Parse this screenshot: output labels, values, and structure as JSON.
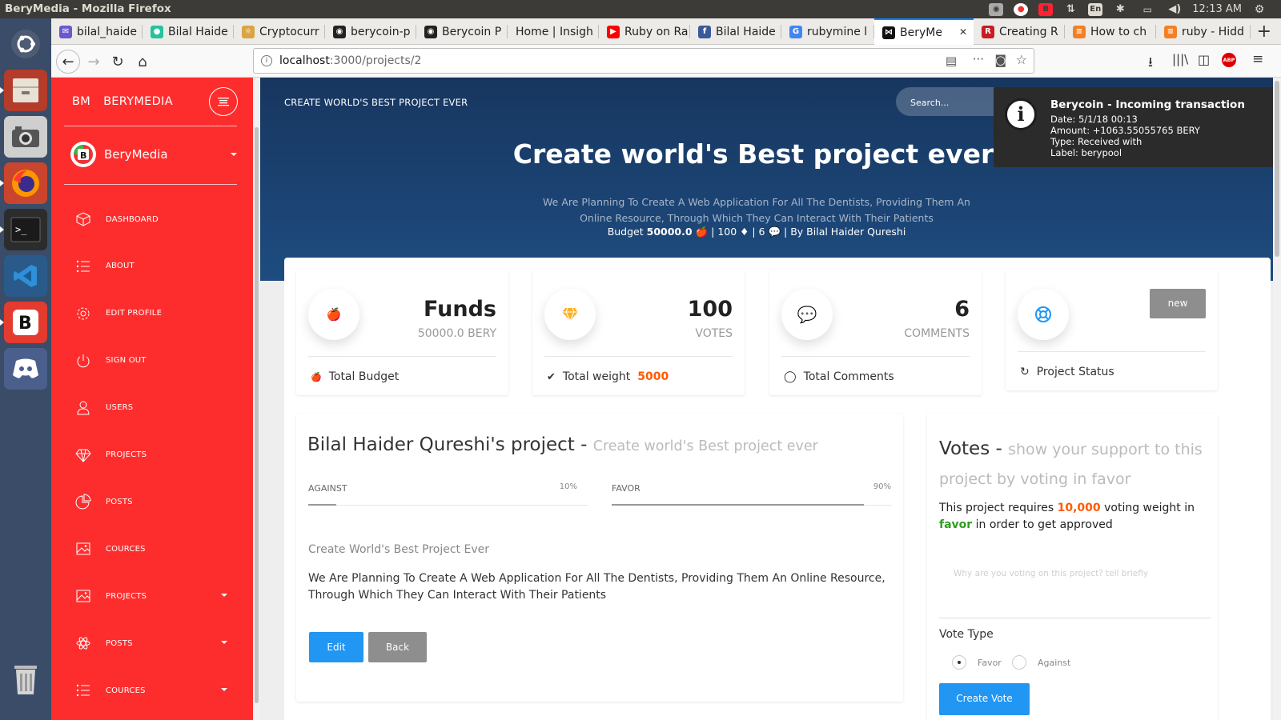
{
  "os": {
    "window_title": "BeryMedia - Mozilla Firefox",
    "tray": {
      "lang": "En",
      "time": "12:13 AM",
      "abp": "ABP"
    }
  },
  "browser": {
    "tabs": [
      {
        "label": "bilal_haide",
        "icon": "mail-icon",
        "color": "#6a5acd"
      },
      {
        "label": "Bilal Haide",
        "icon": "circle-icon",
        "color": "#25c2a0"
      },
      {
        "label": "Cryptocurr",
        "icon": "coin-icon",
        "color": "#d9a441"
      },
      {
        "label": "berycoin-p",
        "icon": "github-icon",
        "color": "#222222"
      },
      {
        "label": "Berycoin P",
        "icon": "github-icon",
        "color": "#222222"
      },
      {
        "label": "Home | Insigh",
        "icon": "",
        "color": ""
      },
      {
        "label": "Ruby on Ra",
        "icon": "youtube-icon",
        "color": "#ff0000"
      },
      {
        "label": "Bilal Haide",
        "icon": "facebook-icon",
        "color": "#3b5998"
      },
      {
        "label": "rubymine l",
        "icon": "google-icon",
        "color": "#4285f4"
      },
      {
        "label": "BeryMe",
        "icon": "bm-icon",
        "color": "#111111"
      },
      {
        "label": "Creating R",
        "icon": "rails-icon",
        "color": "#c61c22"
      },
      {
        "label": "How to ch",
        "icon": "stack-icon",
        "color": "#f48024"
      },
      {
        "label": "ruby - Hidd",
        "icon": "stack-icon",
        "color": "#f48024"
      }
    ],
    "url_host": "localhost",
    "url_path": ":3000/projects/2"
  },
  "sidebar": {
    "logo_short": "BM",
    "logo_name": "BERYMEDIA",
    "user": "BeryMedia",
    "items": [
      {
        "label": "DASHBOARD",
        "icon": "cube-icon",
        "caret": false
      },
      {
        "label": "ABOUT",
        "icon": "list-icon",
        "caret": false
      },
      {
        "label": "EDIT PROFILE",
        "icon": "gear-icon",
        "caret": false
      },
      {
        "label": "SIGN OUT",
        "icon": "power-icon",
        "caret": false
      },
      {
        "label": "USERS",
        "icon": "user-icon",
        "caret": false
      },
      {
        "label": "PROJECTS",
        "icon": "diamond-icon",
        "caret": false
      },
      {
        "label": "POSTS",
        "icon": "pie-icon",
        "caret": false
      },
      {
        "label": "COURCES",
        "icon": "image-icon",
        "caret": false
      },
      {
        "label": "PROJECTS",
        "icon": "image-icon",
        "caret": true
      },
      {
        "label": "POSTS",
        "icon": "atom-icon",
        "caret": true
      },
      {
        "label": "COURCES",
        "icon": "list-icon",
        "caret": true
      }
    ]
  },
  "header": {
    "breadcrumb": "CREATE WORLD'S BEST PROJECT EVER",
    "search_placeholder": "Search...",
    "title": "Create world's Best project ever",
    "description": "We Are Planning To Create A Web Application For All The Dentists, Providing Them An Online Resource, Through Which They Can Interact With Their Patients",
    "meta": {
      "budget_label": "Budget",
      "budget": "50000.0",
      "votes": "100",
      "comments": "6",
      "by": "By Bilal Haider Qureshi"
    }
  },
  "notification": {
    "title": "Berycoin - Incoming transaction",
    "lines": [
      "Date: 5/1/18 00:13",
      "Amount: +1063.55055765 BERY",
      "Type: Received with",
      "Label: berypool"
    ]
  },
  "stats": {
    "funds": {
      "value": "Funds",
      "sub": "50000.0 BERY",
      "footer": "Total Budget"
    },
    "votes": {
      "value": "100",
      "sub": "VOTES",
      "footer": "Total weight",
      "weight": "5000"
    },
    "comments": {
      "value": "6",
      "sub": "COMMENTS",
      "footer": "Total Comments"
    },
    "status": {
      "badge": "new",
      "footer": "Project Status"
    }
  },
  "project": {
    "owner_title": "Bilal Haider Qureshi's project -",
    "subtitle": "Create world's Best project ever",
    "against": {
      "label": "AGAINST",
      "percent": "10%",
      "fraction": 0.1
    },
    "favor": {
      "label": "FAVOR",
      "percent": "90%",
      "fraction": 0.9
    },
    "heading": "Create World's Best Project Ever",
    "body": "We Are Planning To Create A Web Application For All The Dentists, Providing Them An Online Resource, Through Which They Can Interact With Their Patients",
    "edit_label": "Edit",
    "back_label": "Back"
  },
  "votes_panel": {
    "title": "Votes -",
    "subtitle_line1": "show your support to this",
    "subtitle_line2": "project by voting in favor",
    "req_pre": "This project requires",
    "req_weight": "10,000",
    "req_mid": "voting weight in",
    "req_favor": "favor",
    "req_post": "in order to get approved",
    "reason_placeholder": "Why are you voting on this project? tell briefly",
    "vote_type_label": "Vote Type",
    "option_favor": "Favor",
    "option_against": "Against",
    "submit_label": "Create Vote"
  },
  "colors": {
    "sidebar": "#fe2d2d",
    "primary": "#2196f3",
    "accent": "#ff5a00",
    "success": "#2e9e1f"
  }
}
